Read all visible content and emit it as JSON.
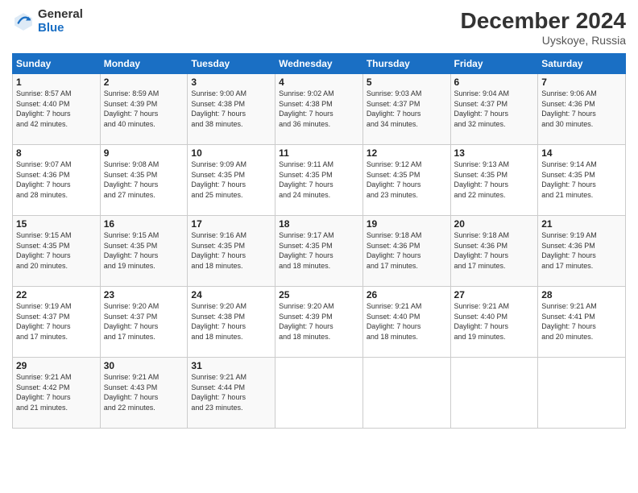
{
  "header": {
    "logo_general": "General",
    "logo_blue": "Blue",
    "month_title": "December 2024",
    "location": "Uyskoye, Russia"
  },
  "days_of_week": [
    "Sunday",
    "Monday",
    "Tuesday",
    "Wednesday",
    "Thursday",
    "Friday",
    "Saturday"
  ],
  "weeks": [
    [
      {
        "day": "1",
        "sunrise": "8:57 AM",
        "sunset": "4:40 PM",
        "daylight": "7 hours and 42 minutes."
      },
      {
        "day": "2",
        "sunrise": "8:59 AM",
        "sunset": "4:39 PM",
        "daylight": "7 hours and 40 minutes."
      },
      {
        "day": "3",
        "sunrise": "9:00 AM",
        "sunset": "4:38 PM",
        "daylight": "7 hours and 38 minutes."
      },
      {
        "day": "4",
        "sunrise": "9:02 AM",
        "sunset": "4:38 PM",
        "daylight": "7 hours and 36 minutes."
      },
      {
        "day": "5",
        "sunrise": "9:03 AM",
        "sunset": "4:37 PM",
        "daylight": "7 hours and 34 minutes."
      },
      {
        "day": "6",
        "sunrise": "9:04 AM",
        "sunset": "4:37 PM",
        "daylight": "7 hours and 32 minutes."
      },
      {
        "day": "7",
        "sunrise": "9:06 AM",
        "sunset": "4:36 PM",
        "daylight": "7 hours and 30 minutes."
      }
    ],
    [
      {
        "day": "8",
        "sunrise": "9:07 AM",
        "sunset": "4:36 PM",
        "daylight": "7 hours and 28 minutes."
      },
      {
        "day": "9",
        "sunrise": "9:08 AM",
        "sunset": "4:35 PM",
        "daylight": "7 hours and 27 minutes."
      },
      {
        "day": "10",
        "sunrise": "9:09 AM",
        "sunset": "4:35 PM",
        "daylight": "7 hours and 25 minutes."
      },
      {
        "day": "11",
        "sunrise": "9:11 AM",
        "sunset": "4:35 PM",
        "daylight": "7 hours and 24 minutes."
      },
      {
        "day": "12",
        "sunrise": "9:12 AM",
        "sunset": "4:35 PM",
        "daylight": "7 hours and 23 minutes."
      },
      {
        "day": "13",
        "sunrise": "9:13 AM",
        "sunset": "4:35 PM",
        "daylight": "7 hours and 22 minutes."
      },
      {
        "day": "14",
        "sunrise": "9:14 AM",
        "sunset": "4:35 PM",
        "daylight": "7 hours and 21 minutes."
      }
    ],
    [
      {
        "day": "15",
        "sunrise": "9:15 AM",
        "sunset": "4:35 PM",
        "daylight": "7 hours and 20 minutes."
      },
      {
        "day": "16",
        "sunrise": "9:15 AM",
        "sunset": "4:35 PM",
        "daylight": "7 hours and 19 minutes."
      },
      {
        "day": "17",
        "sunrise": "9:16 AM",
        "sunset": "4:35 PM",
        "daylight": "7 hours and 18 minutes."
      },
      {
        "day": "18",
        "sunrise": "9:17 AM",
        "sunset": "4:35 PM",
        "daylight": "7 hours and 18 minutes."
      },
      {
        "day": "19",
        "sunrise": "9:18 AM",
        "sunset": "4:36 PM",
        "daylight": "7 hours and 17 minutes."
      },
      {
        "day": "20",
        "sunrise": "9:18 AM",
        "sunset": "4:36 PM",
        "daylight": "7 hours and 17 minutes."
      },
      {
        "day": "21",
        "sunrise": "9:19 AM",
        "sunset": "4:36 PM",
        "daylight": "7 hours and 17 minutes."
      }
    ],
    [
      {
        "day": "22",
        "sunrise": "9:19 AM",
        "sunset": "4:37 PM",
        "daylight": "7 hours and 17 minutes."
      },
      {
        "day": "23",
        "sunrise": "9:20 AM",
        "sunset": "4:37 PM",
        "daylight": "7 hours and 17 minutes."
      },
      {
        "day": "24",
        "sunrise": "9:20 AM",
        "sunset": "4:38 PM",
        "daylight": "7 hours and 18 minutes."
      },
      {
        "day": "25",
        "sunrise": "9:20 AM",
        "sunset": "4:39 PM",
        "daylight": "7 hours and 18 minutes."
      },
      {
        "day": "26",
        "sunrise": "9:21 AM",
        "sunset": "4:40 PM",
        "daylight": "7 hours and 18 minutes."
      },
      {
        "day": "27",
        "sunrise": "9:21 AM",
        "sunset": "4:40 PM",
        "daylight": "7 hours and 19 minutes."
      },
      {
        "day": "28",
        "sunrise": "9:21 AM",
        "sunset": "4:41 PM",
        "daylight": "7 hours and 20 minutes."
      }
    ],
    [
      {
        "day": "29",
        "sunrise": "9:21 AM",
        "sunset": "4:42 PM",
        "daylight": "7 hours and 21 minutes."
      },
      {
        "day": "30",
        "sunrise": "9:21 AM",
        "sunset": "4:43 PM",
        "daylight": "7 hours and 22 minutes."
      },
      {
        "day": "31",
        "sunrise": "9:21 AM",
        "sunset": "4:44 PM",
        "daylight": "7 hours and 23 minutes."
      },
      null,
      null,
      null,
      null
    ]
  ],
  "labels": {
    "sunrise": "Sunrise:",
    "sunset": "Sunset:",
    "daylight": "Daylight:"
  }
}
